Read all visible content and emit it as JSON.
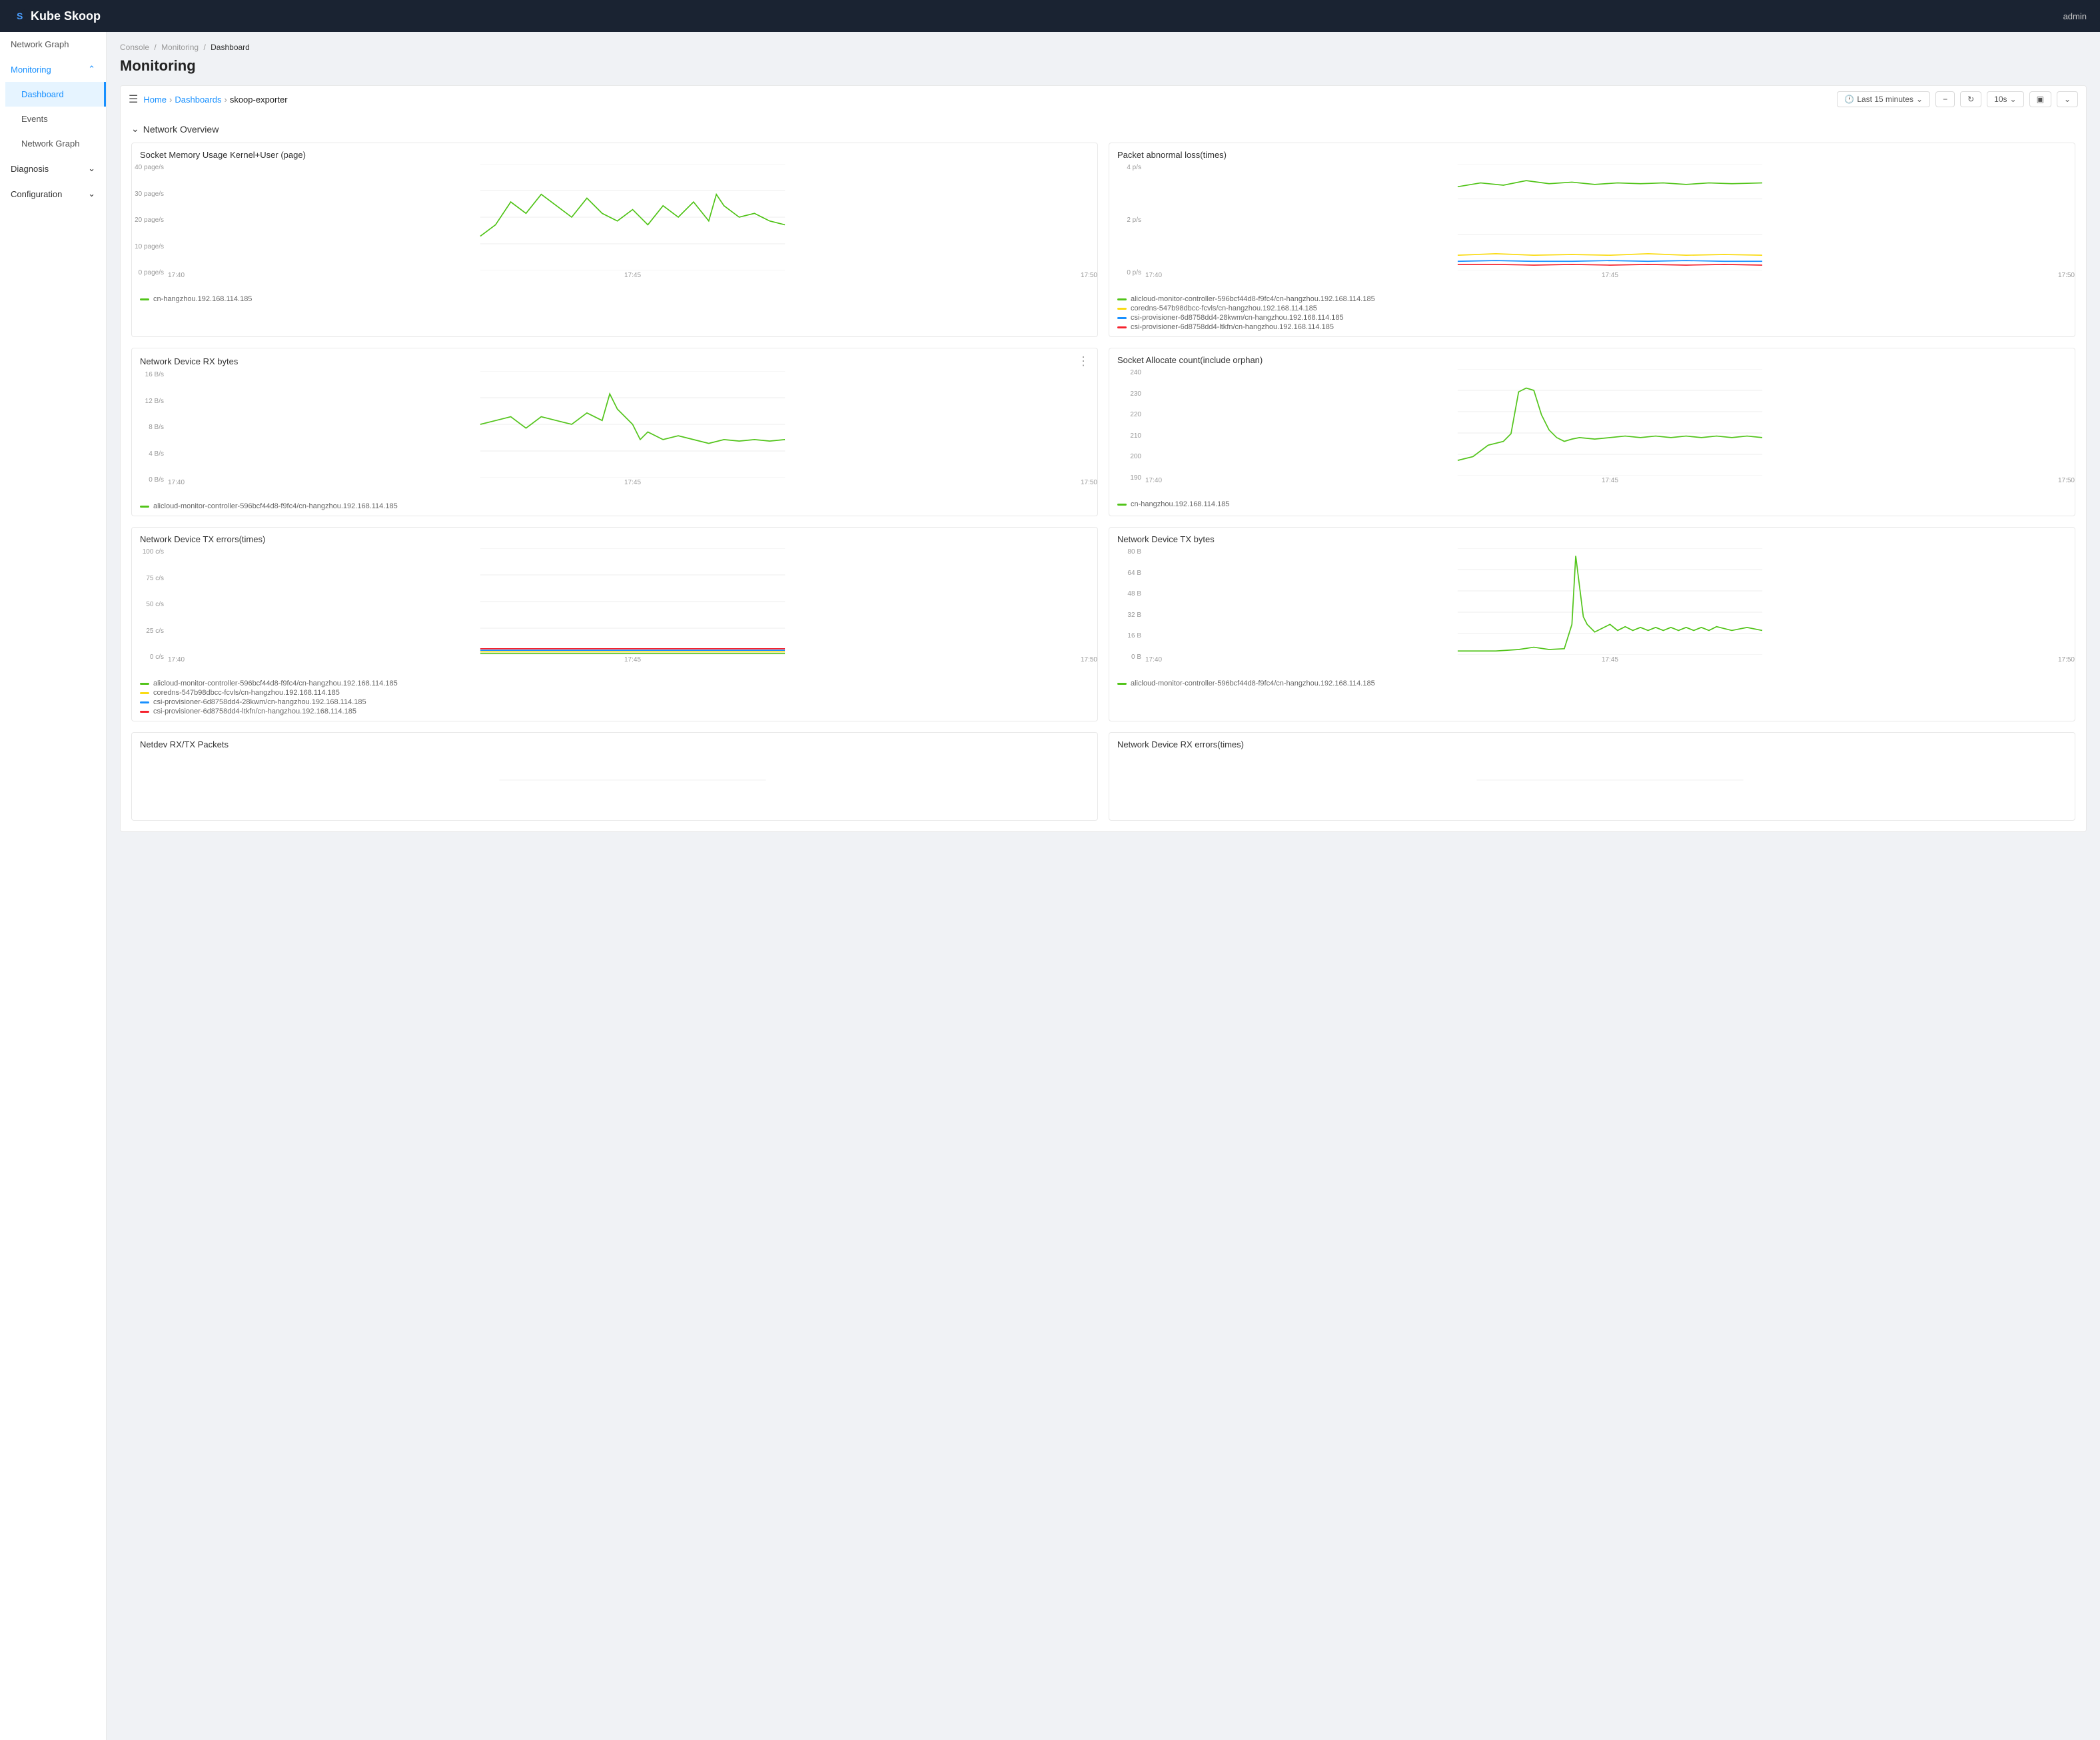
{
  "app": {
    "title": "Kube Skoop",
    "user": "admin"
  },
  "sidebar": {
    "items": [
      {
        "id": "network-graph-top",
        "label": "Network Graph",
        "active": false,
        "indent": false
      },
      {
        "id": "monitoring",
        "label": "Monitoring",
        "active": true,
        "expandable": true,
        "expanded": true
      },
      {
        "id": "dashboard",
        "label": "Dashboard",
        "active": true,
        "sub": true
      },
      {
        "id": "events",
        "label": "Events",
        "active": false,
        "sub": true
      },
      {
        "id": "network-graph",
        "label": "Network Graph",
        "active": false,
        "sub": true
      },
      {
        "id": "diagnosis",
        "label": "Diagnosis",
        "active": false,
        "expandable": true,
        "expanded": false
      },
      {
        "id": "configuration",
        "label": "Configuration",
        "active": false,
        "expandable": true,
        "expanded": false
      }
    ]
  },
  "breadcrumb": {
    "items": [
      "Console",
      "Monitoring",
      "Dashboard"
    ]
  },
  "page": {
    "title": "Monitoring"
  },
  "toolbar": {
    "home": "Home",
    "dashboards": "Dashboards",
    "current": "skoop-exporter",
    "time_range": "Last 15 minutes",
    "refresh": "10s"
  },
  "section": {
    "title": "Network Overview"
  },
  "charts": [
    {
      "id": "socket-memory",
      "title": "Socket Memory Usage Kernel+User (page)",
      "y_labels": [
        "40 page/s",
        "30 page/s",
        "20 page/s",
        "10 page/s",
        "0 page/s"
      ],
      "x_labels": [
        "17:40",
        "17:45",
        "17:50"
      ],
      "legend": [
        {
          "color": "#52c41a",
          "label": "cn-hangzhou.192.168.114.185"
        }
      ],
      "has_menu": false
    },
    {
      "id": "packet-abnormal",
      "title": "Packet abnormal loss(times)",
      "y_labels": [
        "4 p/s",
        "2 p/s",
        "0 p/s"
      ],
      "x_labels": [
        "17:40",
        "17:45",
        "17:50"
      ],
      "legend": [
        {
          "color": "#52c41a",
          "label": "alicloud-monitor-controller-596bcf44d8-f9fc4/cn-hangzhou.192.168.114.185"
        },
        {
          "color": "#fadb14",
          "label": "coredns-547b98dbcc-fcvls/cn-hangzhou.192.168.114.185"
        },
        {
          "color": "#1890ff",
          "label": "csi-provisioner-6d8758dd4-28kwm/cn-hangzhou.192.168.114.185"
        },
        {
          "color": "#f5222d",
          "label": "csi-provisioner-6d8758dd4-ltkfn/cn-hangzhou.192.168.114.185"
        }
      ],
      "has_menu": false,
      "scrollable": true
    },
    {
      "id": "network-device-rx",
      "title": "Network Device RX bytes",
      "y_labels": [
        "16 B/s",
        "12 B/s",
        "8 B/s",
        "4 B/s",
        "0 B/s"
      ],
      "x_labels": [
        "17:40",
        "17:45",
        "17:50"
      ],
      "legend": [
        {
          "color": "#52c41a",
          "label": "alicloud-monitor-controller-596bcf44d8-f9fc4/cn-hangzhou.192.168.114.185"
        }
      ],
      "has_menu": true
    },
    {
      "id": "socket-allocate",
      "title": "Socket Allocate count(include orphan)",
      "y_labels": [
        "240",
        "230",
        "220",
        "210",
        "200",
        "190"
      ],
      "x_labels": [
        "17:40",
        "17:45",
        "17:50"
      ],
      "legend": [
        {
          "color": "#52c41a",
          "label": "cn-hangzhou.192.168.114.185"
        }
      ],
      "has_menu": false
    },
    {
      "id": "netdev-tx-errors",
      "title": "Network Device TX errors(times)",
      "y_labels": [
        "100 c/s",
        "75 c/s",
        "50 c/s",
        "25 c/s",
        "0 c/s"
      ],
      "x_labels": [
        "17:40",
        "17:45",
        "17:50"
      ],
      "legend": [
        {
          "color": "#52c41a",
          "label": "alicloud-monitor-controller-596bcf44d8-f9fc4/cn-hangzhou.192.168.114.185"
        },
        {
          "color": "#fadb14",
          "label": "coredns-547b98dbcc-fcvls/cn-hangzhou.192.168.114.185"
        },
        {
          "color": "#1890ff",
          "label": "csi-provisioner-6d8758dd4-28kwm/cn-hangzhou.192.168.114.185"
        },
        {
          "color": "#f5222d",
          "label": "csi-provisioner-6d8758dd4-ltkfn/cn-hangzhou.192.168.114.185"
        }
      ],
      "has_menu": false,
      "scrollable": true
    },
    {
      "id": "netdev-tx-bytes",
      "title": "Network Device TX bytes",
      "y_labels": [
        "80 B",
        "64 B",
        "48 B",
        "32 B",
        "16 B",
        "0 B"
      ],
      "x_labels": [
        "17:40",
        "17:45",
        "17:50"
      ],
      "legend": [
        {
          "color": "#52c41a",
          "label": "alicloud-monitor-controller-596bcf44d8-f9fc4/cn-hangzhou.192.168.114.185"
        }
      ],
      "has_menu": false
    },
    {
      "id": "netdev-rx-tx-packets",
      "title": "Netdev RX/TX Packets",
      "y_labels": [],
      "x_labels": [],
      "legend": [],
      "has_menu": false
    },
    {
      "id": "netdev-rx-errors",
      "title": "Network Device RX errors(times)",
      "y_labels": [],
      "x_labels": [],
      "legend": [],
      "has_menu": false
    }
  ]
}
